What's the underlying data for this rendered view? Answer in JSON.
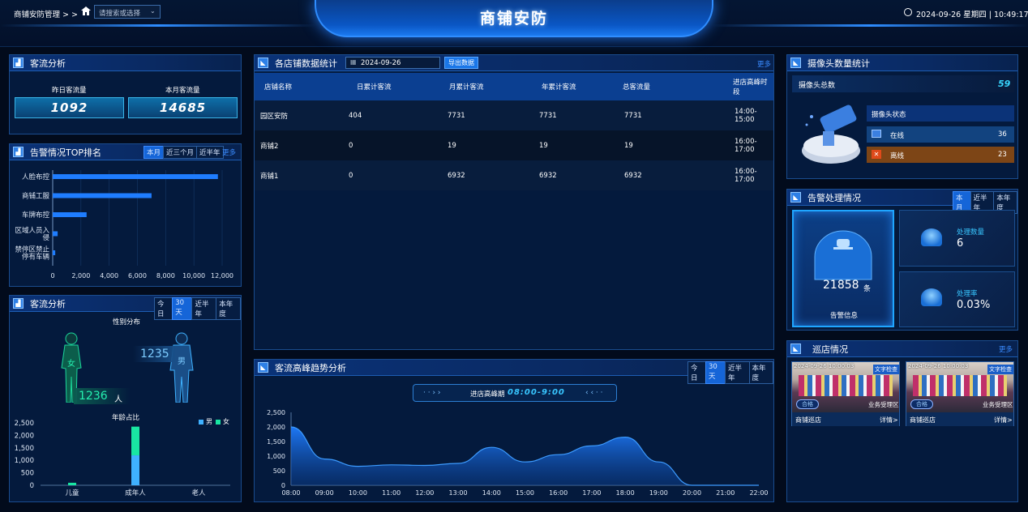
{
  "header": {
    "breadcrumb": "商铺安防管理 > >",
    "search_placeholder": "请搜索或选择",
    "title": "商铺安防",
    "datetime": "2024-09-26 星期四 | 10:49:17"
  },
  "flow": {
    "title": "客流分析",
    "yesterday_label": "昨日客流量",
    "yesterday": "1092",
    "month_label": "本月客流量",
    "month": "14685"
  },
  "alarm_rank": {
    "title": "告警情况TOP排名",
    "tabs": [
      "本月",
      "近三个月",
      "近半年"
    ],
    "more": "更多",
    "chart_data": {
      "type": "bar",
      "orientation": "horizontal",
      "categories": [
        "人脸布控",
        "商铺工服",
        "车牌布控",
        "区域人员入侵",
        "禁停区禁止停有车辆"
      ],
      "category_lines": [
        [
          "人脸布控"
        ],
        [
          "商铺工服"
        ],
        [
          "车牌布控"
        ],
        [
          "区域人员入",
          "侵"
        ],
        [
          "禁停区禁止",
          "停有车辆"
        ]
      ],
      "values": [
        11700,
        7000,
        2400,
        350,
        180
      ],
      "xlim": [
        0,
        12000
      ],
      "xticks": [
        "0",
        "2,000",
        "4,000",
        "6,000",
        "8,000",
        "10,000",
        "12,000"
      ],
      "color": "#1f7dff"
    }
  },
  "flow2": {
    "title": "客流分析",
    "tabs": [
      "今日",
      "30天",
      "近半年",
      "本年度"
    ],
    "gender_title": "性别分布",
    "female_label": "女",
    "female_count": "1236",
    "male_label": "男",
    "male_count": "1235",
    "person_unit": "人",
    "age_title": "年龄占比",
    "legend_male": "男",
    "legend_female": "女",
    "chart_data": {
      "type": "bar",
      "stacked": true,
      "categories": [
        "儿童",
        "成年人",
        "老人"
      ],
      "series": [
        {
          "name": "男",
          "values": [
            0,
            1200,
            0
          ],
          "color": "#3fb1ff"
        },
        {
          "name": "女",
          "values": [
            100,
            1150,
            0
          ],
          "color": "#19e6a2"
        }
      ],
      "ylim": [
        0,
        2500
      ],
      "yticks": [
        "0",
        "500",
        "1,000",
        "1,500",
        "2,000",
        "2,500"
      ]
    }
  },
  "store": {
    "title": "各店铺数据统计",
    "date": "2024-09-26",
    "export": "导出数据",
    "more": "更多",
    "columns": [
      "店铺名称",
      "日累计客流",
      "月累计客流",
      "年累计客流",
      "总客流量",
      "进店高峰时段"
    ],
    "rows": [
      [
        "园区安防",
        "404",
        "7731",
        "7731",
        "7731",
        "14:00-15:00"
      ],
      [
        "商铺2",
        "0",
        "19",
        "19",
        "19",
        "16:00-17:00"
      ],
      [
        "商铺1",
        "0",
        "6932",
        "6932",
        "6932",
        "16:00-17:00"
      ]
    ]
  },
  "trend": {
    "title": "客流高峰趋势分析",
    "tabs": [
      "今日",
      "30天",
      "近半年",
      "本年度"
    ],
    "peak_label": "进店高峰期",
    "peak_value": "08:00-9:00",
    "left_arrows": "· · › ›",
    "right_arrows": "‹ ‹ · ·",
    "chart_data": {
      "type": "area",
      "x": [
        "08:00",
        "09:00",
        "10:00",
        "11:00",
        "12:00",
        "13:00",
        "14:00",
        "15:00",
        "16:00",
        "17:00",
        "18:00",
        "19:00",
        "20:00",
        "21:00",
        "22:00"
      ],
      "values": [
        2000,
        900,
        650,
        700,
        680,
        750,
        1300,
        800,
        1050,
        1350,
        1650,
        800,
        0,
        0,
        0
      ],
      "ylim": [
        0,
        2500
      ],
      "yticks": [
        "0",
        "500",
        "1,000",
        "1,500",
        "2,000",
        "2,500"
      ],
      "color": "#1f7dff"
    }
  },
  "camera": {
    "title": "摄像头数量统计",
    "total_label": "摄像头总数",
    "total": "59",
    "status_label": "摄像头状态",
    "online_label": "在线",
    "online": "36",
    "offline_label": "离线",
    "offline": "23",
    "online_icon": "monitor-icon",
    "offline_icon": "x-icon"
  },
  "alarm_handle": {
    "title": "告警处理情况",
    "tabs": [
      "本月",
      "近半年",
      "本年度"
    ],
    "count": "21858",
    "count_unit": "条",
    "info_label": "告警信息",
    "handled_label": "处理数量",
    "handled": "6",
    "rate_label": "处理率",
    "rate": "0.03%"
  },
  "patrol": {
    "title": "巡店情况",
    "more": "更多",
    "cards": [
      {
        "name": "商铺巡店",
        "detail": "详情>",
        "tag": "文字检查",
        "area": "业务受理区",
        "status": "合格",
        "stamp": "2024-09-26 10:00:03"
      },
      {
        "name": "商铺巡店",
        "detail": "详情>",
        "tag": "文字检查",
        "area": "业务受理区",
        "status": "合格",
        "stamp": "2024-09-26 10:00:03"
      }
    ]
  }
}
